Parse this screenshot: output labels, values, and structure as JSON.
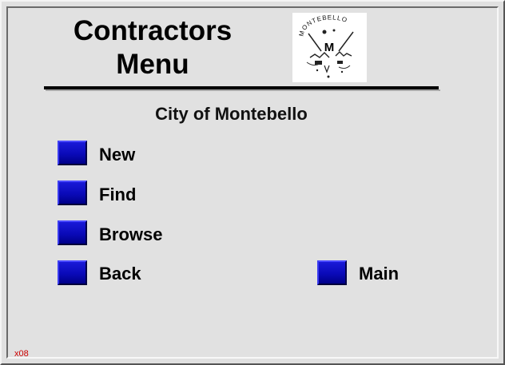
{
  "header": {
    "title_line1": "Contractors",
    "title_line2": "Menu",
    "subtitle": "City of Montebello"
  },
  "logo": {
    "alt": "City of Montebello seal",
    "seal_text": "MONTEBELLO",
    "seal_letter": "M"
  },
  "menu": {
    "new_label": "New",
    "find_label": "Find",
    "browse_label": "Browse",
    "back_label": "Back",
    "main_label": "Main"
  },
  "footer": {
    "code": "x08"
  },
  "colors": {
    "button_blue": "#0a0ab8",
    "background": "#e0e0e0",
    "footer_red": "#cc0000"
  }
}
